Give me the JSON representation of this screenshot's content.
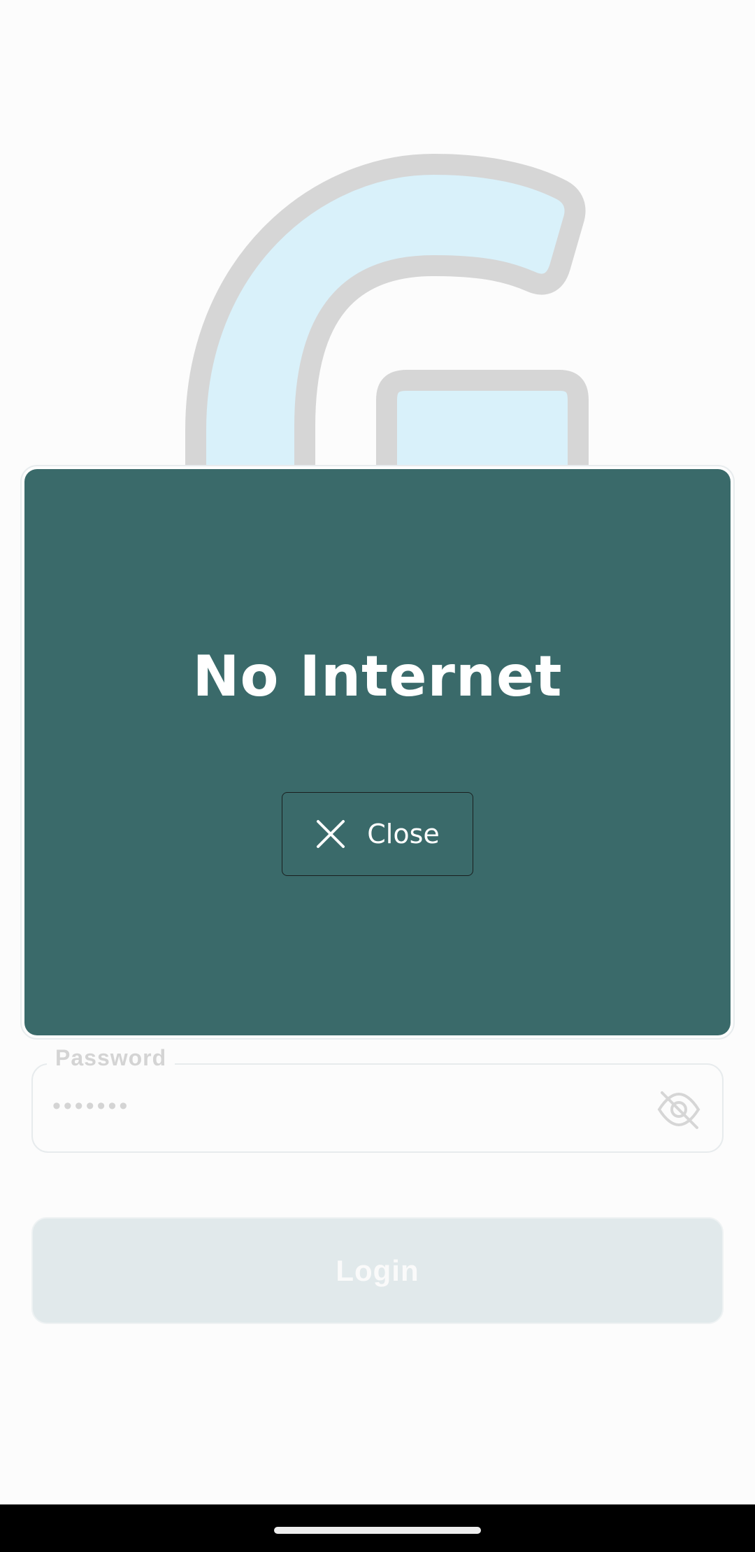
{
  "modal": {
    "title": "No Internet",
    "close_label": "Close"
  },
  "password": {
    "label": "Password",
    "value": "•••••••"
  },
  "login": {
    "label": "Login"
  },
  "icons": {
    "close": "close-icon",
    "visibility": "eye-off-icon",
    "logo": "app-logo"
  },
  "colors": {
    "modal_background": "#3a6a6a",
    "logo_fill": "#d9f1fa",
    "logo_stroke": "#d6d6d6",
    "login_button": "#e1e9eb"
  }
}
